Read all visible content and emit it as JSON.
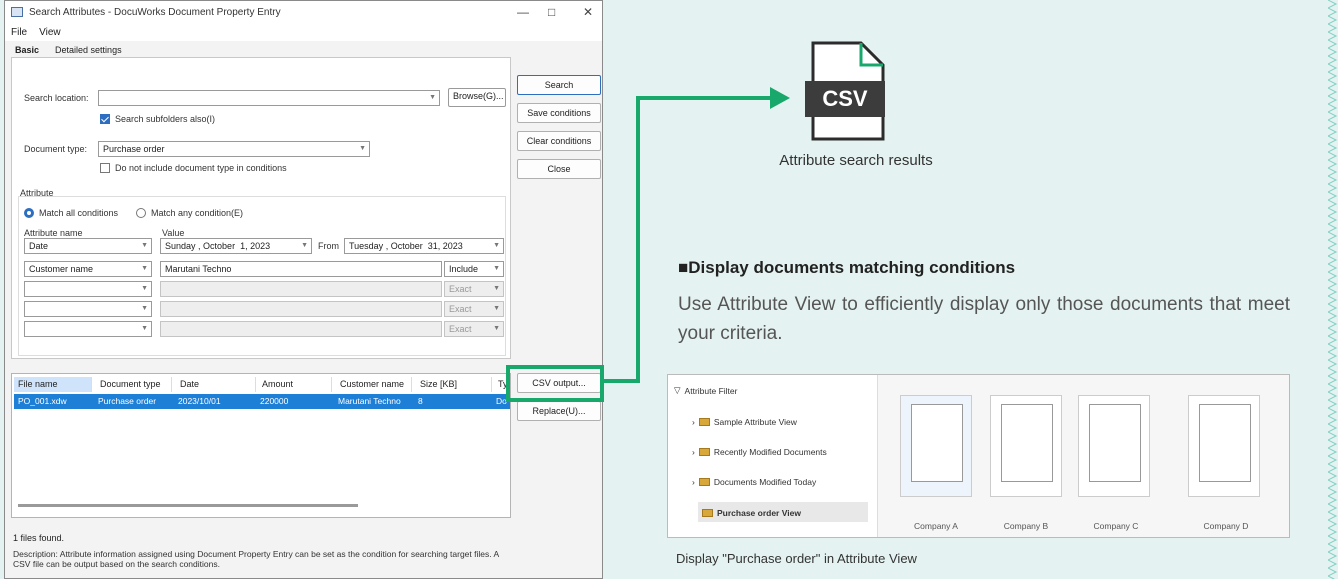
{
  "window": {
    "title": "Search Attributes - DocuWorks Document Property Entry",
    "menu": [
      "File",
      "View"
    ],
    "tabs": [
      "Basic",
      "Detailed settings"
    ],
    "search_location_label": "Search location:",
    "search_location_value": "",
    "browse_label": "Browse(G)...",
    "subfolders_label": "Search subfolders also(I)",
    "document_type_label": "Document type:",
    "document_type_value": "Purchase order",
    "exclude_doctype_label": "Do not include document type in conditions",
    "attribute_group_label": "Attribute",
    "match_all_label": "Match all conditions",
    "match_any_label": "Match any condition(E)",
    "attr_name_header": "Attribute name",
    "value_header": "Value",
    "rows": [
      {
        "name": "Date",
        "date_from": [
          "Sunday",
          "October",
          "1, 2023"
        ],
        "from_label": "From",
        "date_to": [
          "Tuesday",
          "October",
          "31, 2023"
        ]
      },
      {
        "name": "Customer name",
        "value": "Marutani Techno",
        "mode": "Include"
      },
      {
        "name": "",
        "value": "",
        "mode": "Exact"
      },
      {
        "name": "",
        "value": "",
        "mode": "Exact"
      },
      {
        "name": "",
        "value": "",
        "mode": "Exact"
      }
    ],
    "buttons": {
      "search": "Search",
      "save": "Save conditions",
      "clear": "Clear conditions",
      "close": "Close",
      "csv": "CSV output...",
      "replace": "Replace(U)..."
    },
    "results_columns": [
      "File name",
      "Document type",
      "Date",
      "Amount",
      "Customer name",
      "Size [KB]",
      "Ty"
    ],
    "results_row": [
      "PO_001.xdw",
      "Purchase order",
      "2023/10/01",
      "220000",
      "Marutani Techno",
      "8",
      "Do"
    ],
    "status": "1 files found.",
    "description": "Description: Attribute information assigned using Document Property Entry can be set as the condition for searching target files. A CSV file can be output based on the search conditions."
  },
  "csv_icon_label": "CSV",
  "csv_caption": "Attribute search results",
  "section_heading": "■Display documents matching conditions",
  "section_body": "Use Attribute View to efficiently display only those documents that meet your criteria.",
  "attribute_view": {
    "root": "Attribute Filter",
    "items": [
      "Sample Attribute View",
      "Recently Modified Documents",
      "Documents Modified Today",
      "Purchase order View"
    ],
    "thumbnails": [
      "Company A",
      "Company B",
      "Company C",
      "Company D"
    ]
  },
  "screenshot_caption": "Display \"Purchase order\" in Attribute View",
  "colors": {
    "accent_green": "#19a86b",
    "selection_blue": "#1d7fd6",
    "background": "#e4f3f1"
  }
}
